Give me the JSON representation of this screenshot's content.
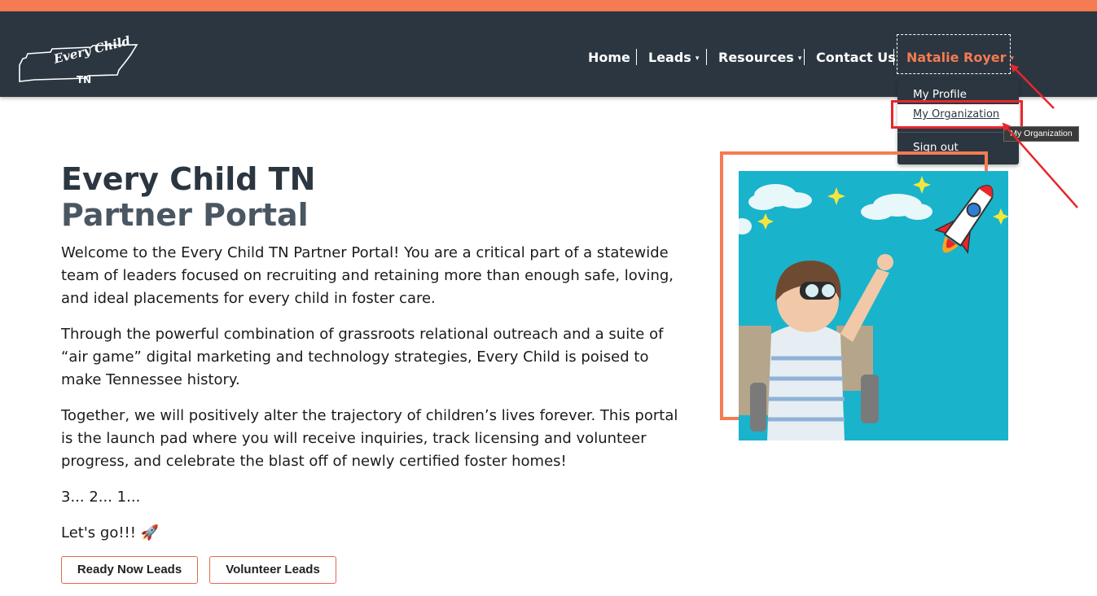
{
  "brand": {
    "logo_text": "Every Child",
    "logo_sub": "TN"
  },
  "nav": {
    "home": "Home",
    "leads": "Leads",
    "resources": "Resources",
    "contact": "Contact Us",
    "user": "Natalie Royer",
    "caret": "▾"
  },
  "user_menu": {
    "profile": "My Profile",
    "organization": "My Organization",
    "signout": "Sign out"
  },
  "tooltip": "My Organization",
  "main": {
    "title_line1": "Every Child TN",
    "title_line2": "Partner Portal",
    "paragraphs": [
      "Welcome to the Every Child TN Partner Portal! You are a critical part of a statewide team of leaders focused on recruiting and retaining more than enough safe, loving, and ideal placements for every child in foster care.",
      "Through the powerful combination of grassroots relational outreach and a suite of “air game” digital marketing and technology strategies, Every Child is poised to make Tennessee history.",
      "Together, we will positively alter the trajectory of children’s lives forever. This portal is the launch pad where you will receive inquiries, track licensing and volunteer progress, and celebrate the blast off of newly certified foster homes!",
      "3... 2... 1...",
      "Let's go!!! 🚀"
    ],
    "buttons": {
      "ready_now": "Ready Now Leads",
      "volunteer": "Volunteer Leads"
    }
  },
  "colors": {
    "accent": "#f47b52",
    "navbar": "#2b3640",
    "annotation": "#e8262b",
    "photo_bg": "#19b3cc"
  }
}
